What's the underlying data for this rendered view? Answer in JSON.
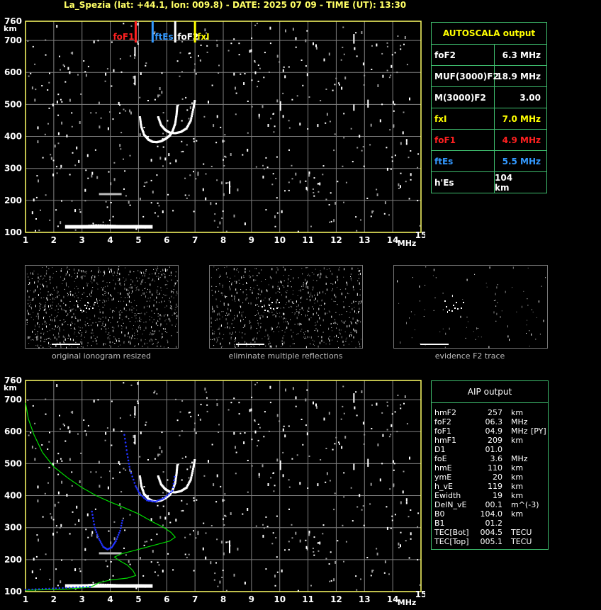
{
  "header": {
    "title": "La_Spezia (lat: +44.1, lon: 009.8) - DATE: 2025 07 09 - TIME (UT): 13:30"
  },
  "colors": {
    "axis": "#ffff66",
    "grid": "#808080",
    "foF1": "#ff2020",
    "ftEs": "#3399ff",
    "foF2": "#ffffff",
    "fxI": "#ffff00",
    "profile": "#00dd00",
    "fit": "#2233ff"
  },
  "chart_data": [
    {
      "type": "scatter",
      "name_id": "main-ionogram",
      "xlabel": "MHz",
      "ylabel": "km",
      "xlim": [
        1,
        15
      ],
      "ylim": [
        100,
        760
      ],
      "xticks": [
        "1",
        "2",
        "3",
        "4",
        "5",
        "6",
        "7",
        "8",
        "9",
        "10",
        "11",
        "12",
        "13",
        "14",
        "15"
      ],
      "yticks": [
        "100",
        "200",
        "300",
        "400",
        "500",
        "600",
        "700",
        "760"
      ],
      "grid": true,
      "markers": [
        {
          "label": "foF1",
          "x": 4.9,
          "color": "#ff2020"
        },
        {
          "label": "ftEs",
          "x": 5.5,
          "color": "#3399ff"
        },
        {
          "label": "foF2",
          "x": 6.3,
          "color": "#ffffff"
        },
        {
          "label": "fxI",
          "x": 7.0,
          "color": "#ffff00"
        }
      ],
      "traces": [
        {
          "name": "F2 ordinary",
          "points": [
            [
              5.05,
              460
            ],
            [
              5.1,
              430
            ],
            [
              5.2,
              405
            ],
            [
              5.35,
              390
            ],
            [
              5.5,
              383
            ],
            [
              5.65,
              382
            ],
            [
              5.8,
              385
            ],
            [
              5.95,
              392
            ],
            [
              6.1,
              402
            ],
            [
              6.2,
              415
            ],
            [
              6.3,
              440
            ],
            [
              6.35,
              470
            ],
            [
              6.38,
              500
            ]
          ]
        },
        {
          "name": "F2 extraordinary",
          "points": [
            [
              5.7,
              460
            ],
            [
              5.8,
              435
            ],
            [
              5.95,
              420
            ],
            [
              6.1,
              412
            ],
            [
              6.3,
              410
            ],
            [
              6.5,
              414
            ],
            [
              6.7,
              425
            ],
            [
              6.85,
              450
            ],
            [
              6.95,
              490
            ],
            [
              7.0,
              515
            ]
          ]
        },
        {
          "name": "Es",
          "points": [
            [
              2.5,
              118
            ],
            [
              3.0,
              119
            ],
            [
              3.5,
              122
            ],
            [
              4.0,
              121
            ],
            [
              4.5,
              119
            ],
            [
              5.0,
              120
            ],
            [
              5.5,
              118
            ]
          ]
        }
      ]
    },
    {
      "type": "line",
      "name_id": "aip-ionogram",
      "xlabel": "MHz",
      "ylabel": "km",
      "xlim": [
        1,
        15
      ],
      "ylim": [
        100,
        760
      ],
      "xticks": [
        "1",
        "2",
        "3",
        "4",
        "5",
        "6",
        "7",
        "8",
        "9",
        "10",
        "11",
        "12",
        "13",
        "14",
        "15"
      ],
      "yticks": [
        "100",
        "200",
        "300",
        "400",
        "500",
        "600",
        "700",
        "760"
      ],
      "grid": true,
      "profile": [
        [
          1.0,
          690
        ],
        [
          1.1,
          640
        ],
        [
          1.3,
          590
        ],
        [
          1.6,
          535
        ],
        [
          2.0,
          490
        ],
        [
          2.5,
          455
        ],
        [
          3.0,
          425
        ],
        [
          3.5,
          400
        ],
        [
          4.0,
          380
        ],
        [
          4.5,
          362
        ],
        [
          5.0,
          343
        ],
        [
          5.5,
          318
        ],
        [
          5.9,
          300
        ],
        [
          6.15,
          285
        ],
        [
          6.3,
          270
        ],
        [
          6.1,
          258
        ],
        [
          5.6,
          246
        ],
        [
          5.0,
          232
        ],
        [
          4.4,
          218
        ],
        [
          4.15,
          208
        ],
        [
          4.3,
          198
        ],
        [
          4.6,
          183
        ],
        [
          4.8,
          166
        ],
        [
          4.9,
          150
        ],
        [
          4.6,
          142
        ],
        [
          4.0,
          136
        ],
        [
          3.6,
          128
        ],
        [
          3.4,
          118
        ],
        [
          3.2,
          113
        ],
        [
          2.5,
          108
        ],
        [
          1.0,
          104
        ]
      ],
      "fit": [
        [
          4.5,
          590
        ],
        [
          4.6,
          530
        ],
        [
          4.7,
          480
        ],
        [
          4.9,
          430
        ],
        [
          5.05,
          405
        ],
        [
          5.3,
          385
        ],
        [
          5.6,
          381
        ],
        [
          5.9,
          392
        ],
        [
          6.2,
          415
        ],
        [
          6.3,
          470
        ]
      ],
      "fit_low": [
        [
          3.35,
          350
        ],
        [
          3.45,
          300
        ],
        [
          3.6,
          265
        ],
        [
          3.75,
          240
        ],
        [
          3.9,
          232
        ],
        [
          4.05,
          238
        ],
        [
          4.2,
          258
        ],
        [
          4.35,
          290
        ],
        [
          4.45,
          330
        ]
      ],
      "traces": [
        {
          "name": "F2 ordinary",
          "points": [
            [
              5.05,
              460
            ],
            [
              5.1,
              430
            ],
            [
              5.2,
              405
            ],
            [
              5.35,
              390
            ],
            [
              5.5,
              383
            ],
            [
              5.65,
              382
            ],
            [
              5.8,
              385
            ],
            [
              5.95,
              392
            ],
            [
              6.1,
              402
            ],
            [
              6.2,
              415
            ],
            [
              6.3,
              440
            ],
            [
              6.35,
              470
            ],
            [
              6.38,
              500
            ]
          ]
        },
        {
          "name": "F2 extraordinary",
          "points": [
            [
              5.7,
              460
            ],
            [
              5.8,
              435
            ],
            [
              5.95,
              420
            ],
            [
              6.1,
              412
            ],
            [
              6.3,
              410
            ],
            [
              6.5,
              414
            ],
            [
              6.7,
              425
            ],
            [
              6.85,
              450
            ],
            [
              6.95,
              490
            ],
            [
              7.0,
              515
            ]
          ]
        },
        {
          "name": "Es",
          "points": [
            [
              2.5,
              118
            ],
            [
              3.0,
              119
            ],
            [
              3.5,
              122
            ],
            [
              4.0,
              121
            ],
            [
              4.5,
              119
            ],
            [
              5.0,
              120
            ],
            [
              5.5,
              118
            ]
          ]
        }
      ]
    }
  ],
  "autoscala": {
    "title": "AUTOSCALA output",
    "rows": [
      {
        "key": "foF2",
        "val": "6.3 MHz",
        "color": "#ffffff"
      },
      {
        "key": "MUF(3000)F2",
        "val": "18.9 MHz",
        "color": "#ffffff"
      },
      {
        "key": "M(3000)F2",
        "val": "3.00",
        "color": "#ffffff"
      },
      {
        "key": "fxI",
        "val": "7.0 MHz",
        "color": "#ffff00"
      },
      {
        "key": "foF1",
        "val": "4.9 MHz",
        "color": "#ff2020"
      },
      {
        "key": "ftEs",
        "val": "5.5 MHz",
        "color": "#3399ff"
      },
      {
        "key": "h'Es",
        "val": "104",
        "unit": "km",
        "color": "#ffffff"
      }
    ]
  },
  "thumbnails": [
    {
      "caption": "original ionogram resized"
    },
    {
      "caption": "eliminate multiple reflections"
    },
    {
      "caption": "evidence F2 trace"
    }
  ],
  "aip": {
    "title": "AIP output",
    "rows": [
      [
        "hmF2",
        "257",
        "km",
        ""
      ],
      [
        "foF2",
        "06.3",
        "MHz",
        ""
      ],
      [
        "foF1",
        "04.9",
        "MHz",
        "[PY]"
      ],
      [
        "hmF1",
        "209",
        "km",
        ""
      ],
      [
        "D1",
        "01.0",
        "",
        ""
      ],
      [
        "foE",
        "3.6",
        "MHz",
        ""
      ],
      [
        "hmE",
        "110",
        "km",
        ""
      ],
      [
        "ymE",
        "20",
        "km",
        ""
      ],
      [
        "h_vE",
        "119",
        "km",
        ""
      ],
      [
        "Ewidth",
        "19",
        "km",
        ""
      ],
      [
        "DelN_vE",
        "00.1",
        "m^(-3)",
        ""
      ],
      [
        "B0",
        "104.0",
        "km",
        ""
      ],
      [
        "B1",
        "01.2",
        "",
        ""
      ],
      [
        "TEC[Bot]",
        "004.5",
        "TECU",
        ""
      ],
      [
        "TEC[Top]",
        "005.1",
        "TECU",
        ""
      ]
    ]
  }
}
